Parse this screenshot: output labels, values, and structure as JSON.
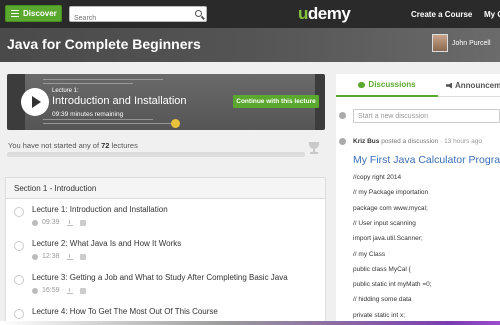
{
  "topnav": {
    "discover_label": "Discover",
    "search_placeholder": "Search",
    "logo_prefix": "u",
    "logo_rest": "demy",
    "create_course": "Create a Course",
    "my_courses": "My C"
  },
  "course": {
    "title": "Java for Complete Beginners",
    "instructor": "John Purcell"
  },
  "player": {
    "lecture_number": "Lecture 1:",
    "lecture_title": "Introduction and Installation",
    "remaining": "09:39 minutes remaining",
    "continue_label": "Continue with this lecture"
  },
  "progress": {
    "prefix": "You have not started any of",
    "count": "72",
    "suffix": "lectures",
    "fraction": 0
  },
  "curriculum": {
    "section": "Section 1 - Introduction",
    "lectures": [
      {
        "title": "Lecture 1: Introduction and Installation",
        "duration": "09:39"
      },
      {
        "title": "Lecture 2: What Java Is and How It Works",
        "duration": "12:38"
      },
      {
        "title": "Lecture 3: Getting a Job and What to Study After Completing Basic Java",
        "duration": "16:59"
      },
      {
        "title": "Lecture 4: How To Get The Most Out Of This Course",
        "duration": ""
      }
    ]
  },
  "discussions": {
    "tab_discussions": "Discussions",
    "tab_announcements": "Announcements",
    "new_placeholder": "Start a new discussion",
    "author": "Kriz Bus",
    "action": "posted a discussion",
    "ago": "· 13 hours ago",
    "post_title": "My First Java Calculator Program",
    "code": [
      "//copy right 2014",
      "// my Package importation",
      "package com www.mycal;",
      "// User input scanning",
      "import java.util.Scanner;",
      "// my Class",
      "public class MyCal {",
      "public static int myMath =0;",
      "// hidding some data",
      "private static int x;"
    ]
  },
  "colors": {
    "accent_green": "#5ba82e",
    "link_blue": "#3b6fb6",
    "nav_dark": "#2a2a2a"
  }
}
